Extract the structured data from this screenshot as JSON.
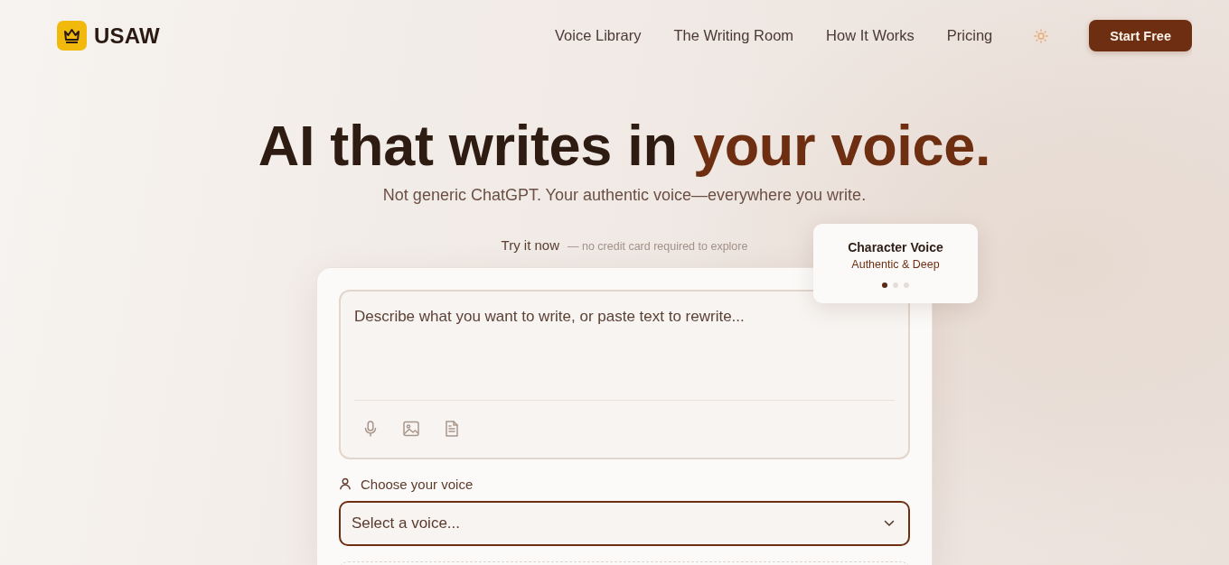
{
  "nav": {
    "brand": "USAW",
    "links": [
      {
        "label": "Voice Library"
      },
      {
        "label": "The Writing Room"
      },
      {
        "label": "How It Works"
      },
      {
        "label": "Pricing"
      }
    ],
    "cta": "Start Free"
  },
  "hero": {
    "title": "AI that writes in",
    "title_highlight": "your voice.",
    "subtitle": "Not generic ChatGPT. Your authentic voice—everywhere you write."
  },
  "try_it": {
    "label": "Try it now",
    "note": "— no credit card required to explore"
  },
  "composer": {
    "placeholder": "Describe what you want to write, or paste text to rewrite..."
  },
  "voice_select": {
    "label": "Choose your voice",
    "placeholder": "Select a voice..."
  },
  "floating_card": {
    "title": "Character Voice",
    "subtitle": "Authentic & Deep",
    "dots": [
      {
        "selected": true
      },
      {
        "selected": false
      },
      {
        "selected": false
      }
    ]
  }
}
